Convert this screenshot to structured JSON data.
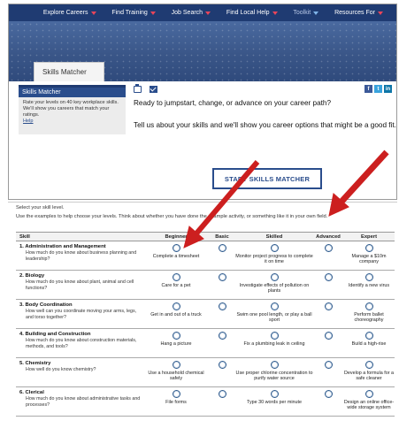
{
  "nav": {
    "items": [
      {
        "label": "Explore Careers",
        "caret": "#e8455a"
      },
      {
        "label": "Find Training",
        "caret": "#e8455a"
      },
      {
        "label": "Job Search",
        "caret": "#e8455a"
      },
      {
        "label": "Find Local Help",
        "caret": "#e8455a"
      },
      {
        "label": "Toolkit",
        "caret": "#7fb3e8"
      },
      {
        "label": "Resources For",
        "caret": "#e8455a"
      }
    ]
  },
  "banner": {
    "tab_label": "Skills Matcher"
  },
  "sidebar": {
    "heading": "Skills Matcher",
    "text": "Rate your levels on 40 key workplace skills. We'll show you careers that match your ratings.",
    "link": "Help"
  },
  "tools": {
    "print_icon": "print-icon",
    "email_icon": "email-icon"
  },
  "social": {
    "facebook": "f",
    "twitter": "t",
    "linkedin": "in"
  },
  "main": {
    "headline": "Ready to jumpstart, change, or advance on your career path?",
    "subline": "Tell us about your skills and we'll show you career options that might be a good fit.",
    "start_button": "START SKILLS MATCHER"
  },
  "form": {
    "instruction1": "Select your skill level.",
    "instruction2": "Use the examples to help choose your levels. Think about whether you have done the example activity, or something like it in your own field.",
    "headers": [
      "Skill",
      "Beginner",
      "Basic",
      "Skilled",
      "Advanced",
      "Expert"
    ],
    "rows": [
      {
        "name": "1. Administration and Management",
        "question": "How much do you know about business planning and leadership?",
        "beginner": "Complete a timesheet",
        "skilled": "Monitor project progress to complete it on time",
        "expert": "Manage a $10m company"
      },
      {
        "name": "2. Biology",
        "question": "How much do you know about plant, animal and cell functions?",
        "beginner": "Care for a pet",
        "skilled": "Investigate effects of pollution on plants",
        "expert": "Identify a new virus"
      },
      {
        "name": "3. Body Coordination",
        "question": "How well can you coordinate moving your arms, legs, and torso together?",
        "beginner": "Get in and out of a truck",
        "skilled": "Swim one pool length, or play a ball sport",
        "expert": "Perform ballet choreography"
      },
      {
        "name": "4. Building and Construction",
        "question": "How much do you know about construction materials, methods, and tools?",
        "beginner": "Hang a picture",
        "skilled": "Fix a plumbing leak in ceiling",
        "expert": "Build a high-rise"
      },
      {
        "name": "5. Chemistry",
        "question": "How well do you know chemistry?",
        "beginner": "Use a household chemical safely",
        "skilled": "Use proper chlorine concentration to purify water source",
        "expert": "Develop a formula for a safe cleaner"
      },
      {
        "name": "6. Clerical",
        "question": "How much do you know about administrative tasks and processes?",
        "beginner": "File forms",
        "skilled": "Type 30 words per minute",
        "expert": "Design an online office-wide storage system"
      }
    ]
  },
  "colors": {
    "nav_bg": "#1f3b72",
    "accent": "#2a4d8c",
    "arrow": "#cc1f1f"
  }
}
